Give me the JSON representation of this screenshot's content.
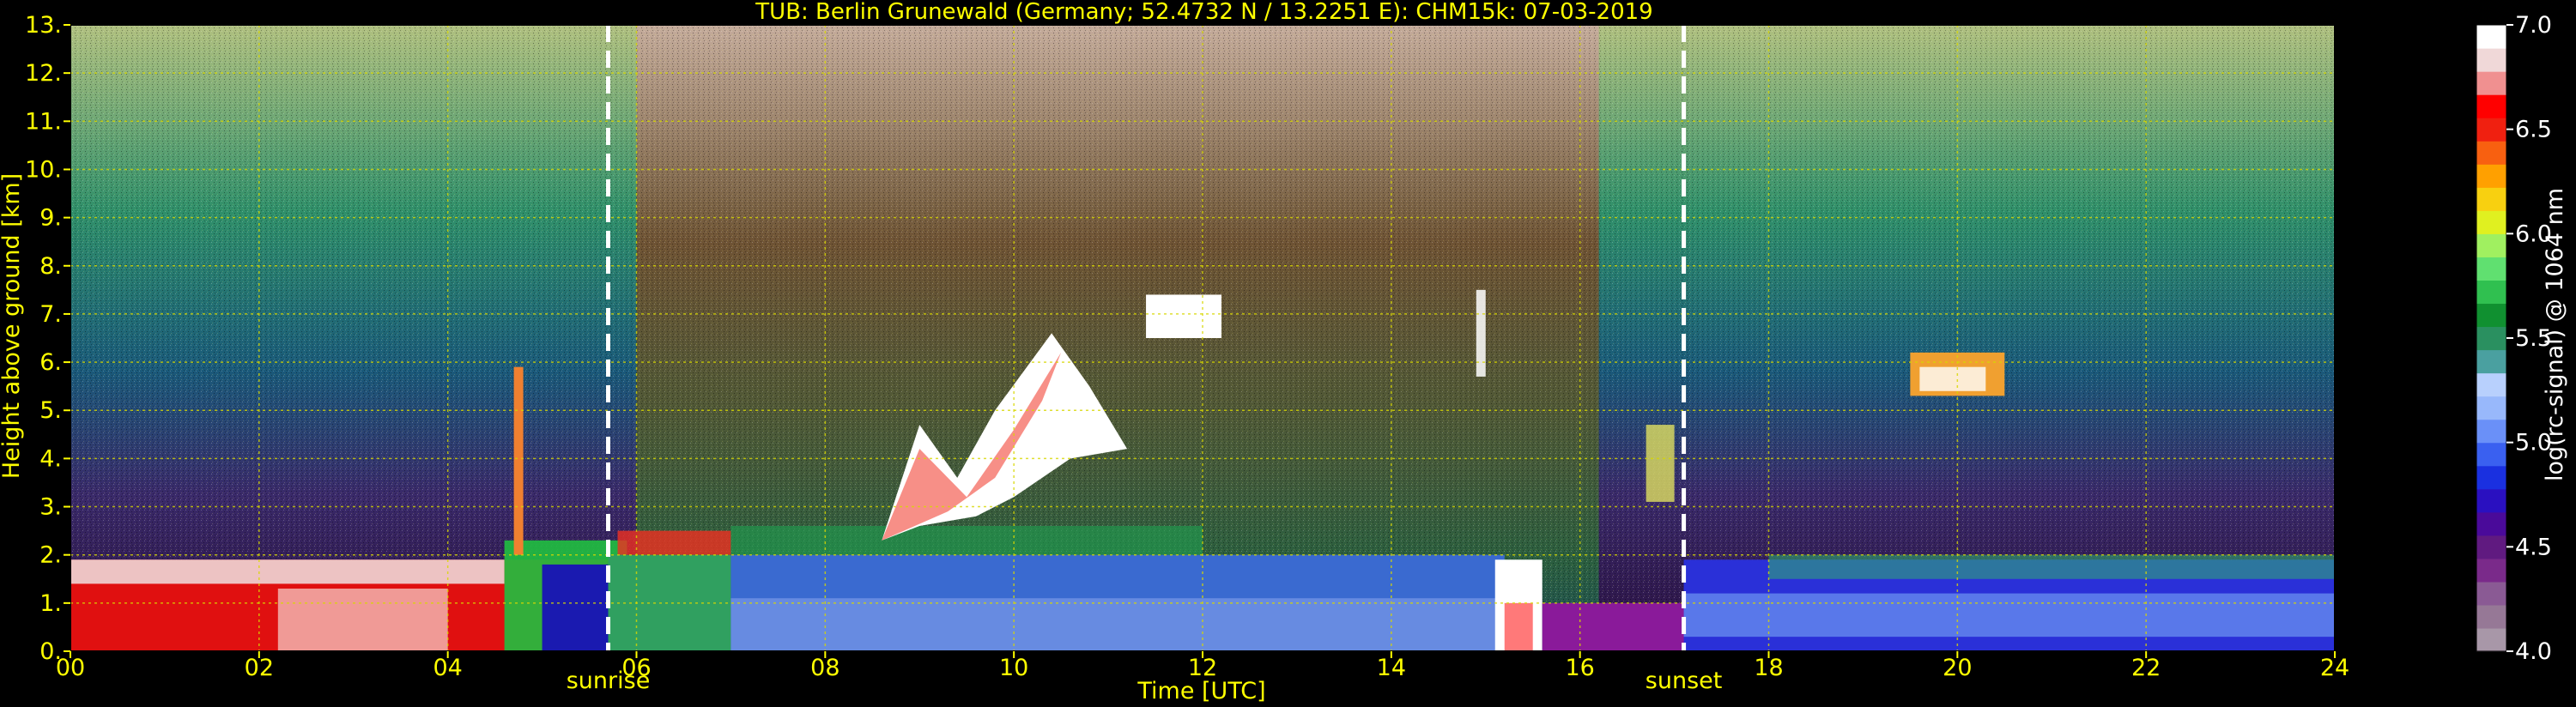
{
  "chart_data": {
    "type": "heatmap",
    "title": "TUB: Berlin Grunewald (Germany; 52.4732 N / 13.2251 E):    CHM15k: 07-03-2019",
    "xlabel": "Time [UTC]",
    "ylabel": "Height above ground [km]",
    "xlim": [
      0,
      24
    ],
    "ylim": [
      0,
      13
    ],
    "x_ticks": [
      "00",
      "02",
      "04",
      "06",
      "08",
      "10",
      "12",
      "14",
      "16",
      "18",
      "20",
      "22",
      "24"
    ],
    "y_ticks": [
      "0.",
      "1.",
      "2.",
      "3.",
      "4.",
      "5.",
      "6.",
      "7.",
      "8.",
      "9.",
      "10.",
      "11.",
      "12.",
      "13."
    ],
    "grid": true,
    "colorbar": {
      "label": "log(rc-signal) @ 1064 nm",
      "range": [
        4.0,
        7.0
      ],
      "ticks": [
        "4.0",
        "4.5",
        "5.0",
        "5.5",
        "6.0",
        "6.5",
        "7.0"
      ],
      "colors": [
        "#a897a8",
        "#967896",
        "#8a5a94",
        "#7a2a8a",
        "#601a80",
        "#4a0a9a",
        "#2a10c0",
        "#1a30e0",
        "#3a60f0",
        "#6a90f8",
        "#98b8fb",
        "#b8d0fd",
        "#4aa0a0",
        "#2a9060",
        "#109030",
        "#30c050",
        "#60e070",
        "#a0f060",
        "#e0f020",
        "#f8d010",
        "#ffa000",
        "#f86010",
        "#f02010",
        "#ff0000",
        "#f09090",
        "#f0d8d8",
        "#ffffff"
      ]
    },
    "markers": [
      {
        "label": "sunrise",
        "x": 5.7
      },
      {
        "label": "sunset",
        "x": 17.1
      }
    ],
    "features": [
      {
        "kind": "boundary layer",
        "x": [
          0,
          24
        ],
        "top_km": 2.0
      },
      {
        "kind": "elevated aerosol/cloud",
        "x": [
          8.5,
          11.5
        ],
        "height_km": [
          2.5,
          7.0
        ]
      },
      {
        "kind": "cloud",
        "x": [
          19.5,
          20.5
        ],
        "height_km": [
          5.3,
          6.2
        ]
      }
    ]
  }
}
